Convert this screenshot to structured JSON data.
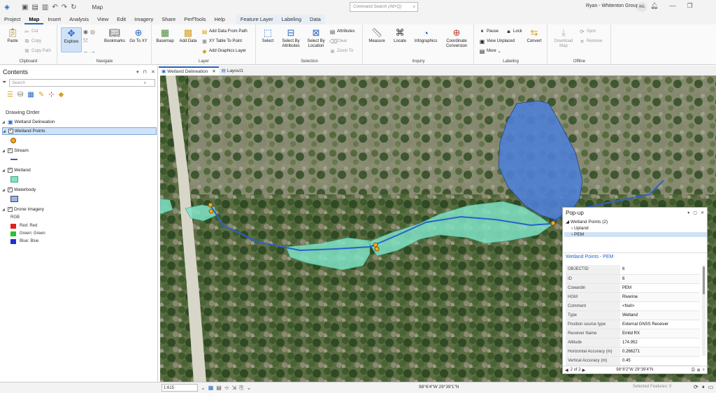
{
  "titlebar": {
    "title": "Map",
    "command_search_placeholder": "Command Search (Alt+Q)",
    "user": "Ryan - Whitenton Group",
    "avatar_initials": "RG"
  },
  "ribbon_tabs": [
    "Project",
    "Map",
    "Insert",
    "Analysis",
    "View",
    "Edit",
    "Imagery",
    "Share",
    "PerfTools",
    "Help"
  ],
  "context_tabs": [
    "Feature Layer",
    "Labeling",
    "Data"
  ],
  "active_tab": "Map",
  "ribbon": {
    "clipboard": {
      "label": "Clipboard",
      "paste": "Paste",
      "cut": "Cut",
      "copy": "Copy",
      "copy_path": "Copy Path"
    },
    "navigate": {
      "label": "Navigate",
      "explore": "Explore",
      "bookmarks": "Bookmarks",
      "go_to_xy": "Go To XY"
    },
    "layer": {
      "label": "Layer",
      "basemap": "Basemap",
      "add_data": "Add Data",
      "add_data_from_path": "Add Data From Path",
      "xy_table_to_point": "XY Table To Point",
      "add_graphics_layer": "Add Graphics Layer"
    },
    "selection": {
      "label": "Selection",
      "select": "Select",
      "select_by_attributes": "Select By Attributes",
      "select_by_location": "Select By Location",
      "attributes": "Attributes",
      "clear": "Clear",
      "zoom_to": "Zoom To"
    },
    "inquiry": {
      "label": "Inquiry",
      "measure": "Measure",
      "locate": "Locate",
      "infographics": "Infographics",
      "coordinate_conversion": "Coordinate Conversion"
    },
    "labeling": {
      "label": "Labeling",
      "pause": "Pause",
      "lock": "Lock",
      "view_unplaced": "View Unplaced",
      "more": "More",
      "convert": "Convert"
    },
    "offline": {
      "label": "Offline",
      "download_map": "Download Map",
      "sync": "Sync",
      "remove": "Remove"
    }
  },
  "contents": {
    "title": "Contents",
    "search_placeholder": "Search",
    "drawing_order": "Drawing Order",
    "map_name": "Wetland Delineation",
    "layers": [
      {
        "name": "Wetland Points"
      },
      {
        "name": "Stream"
      },
      {
        "name": "Wetland"
      },
      {
        "name": "Waterbody"
      },
      {
        "name": "Drone Imagery"
      }
    ],
    "rgb_title": "RGB",
    "rgb_bands": [
      {
        "label": "Red:  Red",
        "color": "#e0221b"
      },
      {
        "label": "Green: Green",
        "color": "#2fbf2f"
      },
      {
        "label": "Blue:  Blue",
        "color": "#1f2fd6"
      }
    ]
  },
  "view_tabs": [
    "Wetland Delineation",
    "Layout1"
  ],
  "popup": {
    "title": "Pop-up",
    "tree_root": "Wetland Points (2)",
    "tree_items": [
      "Upland",
      "PEM"
    ],
    "header": "Wetland Points - PEM",
    "attributes": [
      {
        "k": "OBJECTID",
        "v": "6"
      },
      {
        "k": "ID",
        "v": "6"
      },
      {
        "k": "Cowardin",
        "v": "PEM"
      },
      {
        "k": "HGM",
        "v": "Riverine"
      },
      {
        "k": "Comment",
        "v": "<Null>"
      },
      {
        "k": "Type",
        "v": "Wetland"
      },
      {
        "k": "Position source type",
        "v": "External GNSS Receiver"
      },
      {
        "k": "Receiver Name",
        "v": "Emlid RX"
      },
      {
        "k": "Altitude",
        "v": "174.952"
      },
      {
        "k": "Horizontal Accuracy (m)",
        "v": "0.266271"
      },
      {
        "k": "Vertical Accuracy (m)",
        "v": "0.45"
      }
    ],
    "paging": "2 of 2",
    "coords": "98°8'2\"W 29°39'4\"N"
  },
  "status": {
    "scale": "1:615",
    "coords": "98°6'4\"W 29°39'1\"N",
    "selected_features": "Selected Features: 0"
  },
  "colors": {
    "accent": "#2566c4",
    "wetland_fill": "#7fe3c4",
    "waterbody_fill": "#4f7fd6",
    "stream": "#2a62c9",
    "point": "#f5a623"
  }
}
